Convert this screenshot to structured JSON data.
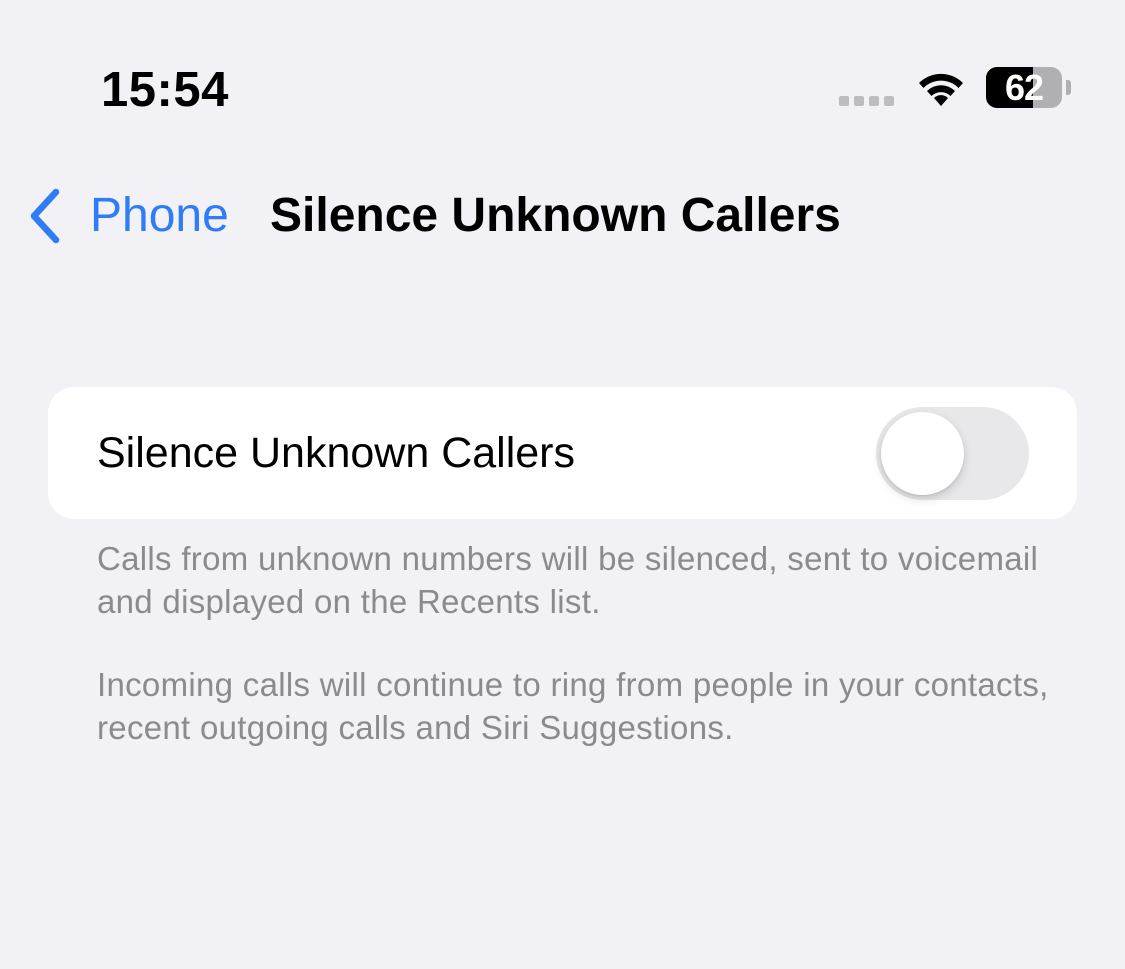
{
  "status_bar": {
    "time": "15:54",
    "battery_level": "62",
    "battery_fraction": 0.62,
    "signal_icon": "signal-dots-icon",
    "wifi_icon": "wifi-icon"
  },
  "nav": {
    "back_label": "Phone",
    "back_icon": "chevron-left-icon",
    "title": "Silence Unknown Callers"
  },
  "settings": {
    "row_label": "Silence Unknown Callers",
    "toggle_on": false
  },
  "footer": {
    "paragraph_1": "Calls from unknown numbers will be silenced, sent to voicemail and displayed on the Recents list.",
    "paragraph_2": "Incoming calls will continue to ring from people in your contacts, recent outgoing calls and Siri Suggestions."
  },
  "colors": {
    "background": "#f2f1f6",
    "accent": "#2f7cf6",
    "card": "#ffffff",
    "toggle_off": "#e8e8ea",
    "secondary_text": "#8a8a8f"
  }
}
